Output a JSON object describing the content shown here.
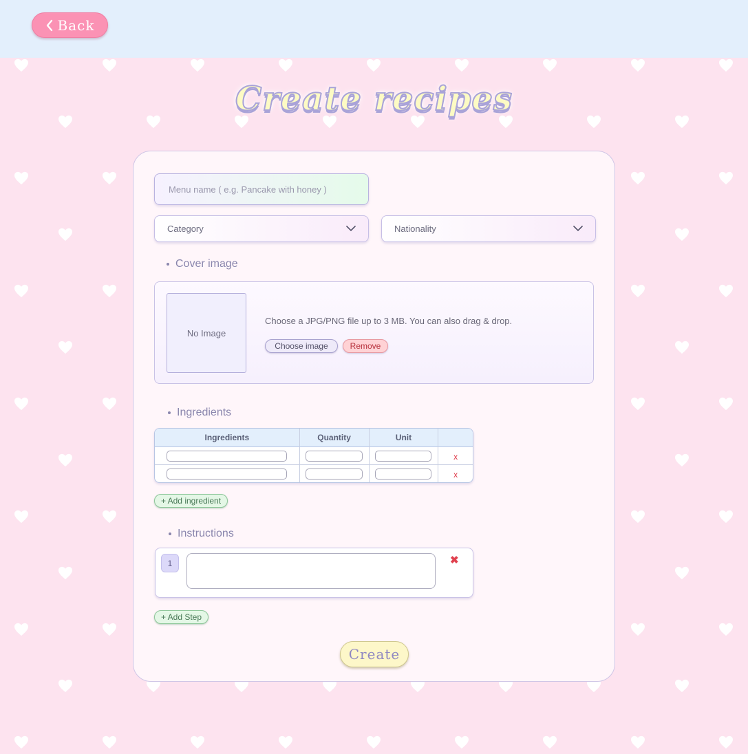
{
  "nav": {
    "back_label": "Back"
  },
  "page": {
    "title": "Create recipes"
  },
  "form": {
    "menu_name_placeholder": "Menu name ( e.g. Pancake with honey )",
    "category": {
      "selected": "Category"
    },
    "nationality": {
      "selected": "Nationality"
    }
  },
  "cover": {
    "label": "Cover image",
    "no_image_text": "No Image",
    "hint": "Choose a JPG/PNG file up to 3 MB. You can also drag & drop.",
    "choose_label": "Choose image",
    "remove_label": "Remove"
  },
  "ingredients": {
    "label": "Ingredients",
    "headers": [
      "Ingredients",
      "Quantity",
      "Unit",
      ""
    ],
    "rows": [
      {
        "ingredient": "",
        "quantity": "",
        "unit": "",
        "delete": "x"
      },
      {
        "ingredient": "",
        "quantity": "",
        "unit": "",
        "delete": "x"
      }
    ],
    "add_label": "+ Add ingredient"
  },
  "instructions": {
    "label": "Instructions",
    "steps": [
      {
        "number": "1",
        "text": "",
        "delete": "✖"
      }
    ],
    "add_label": "+ Add Step"
  },
  "actions": {
    "create_label": "Create"
  },
  "icons": {
    "back": "chevron-left-icon",
    "dropdown": "chevron-down-icon",
    "background": "heart-icon"
  },
  "colors": {
    "topbar": "#e3effc",
    "background": "#fde3ef",
    "back_button": "#fb92b4",
    "create_button": "#fdf7c9",
    "delete": "#e0414f",
    "add_pill": "#e4f7e6"
  }
}
